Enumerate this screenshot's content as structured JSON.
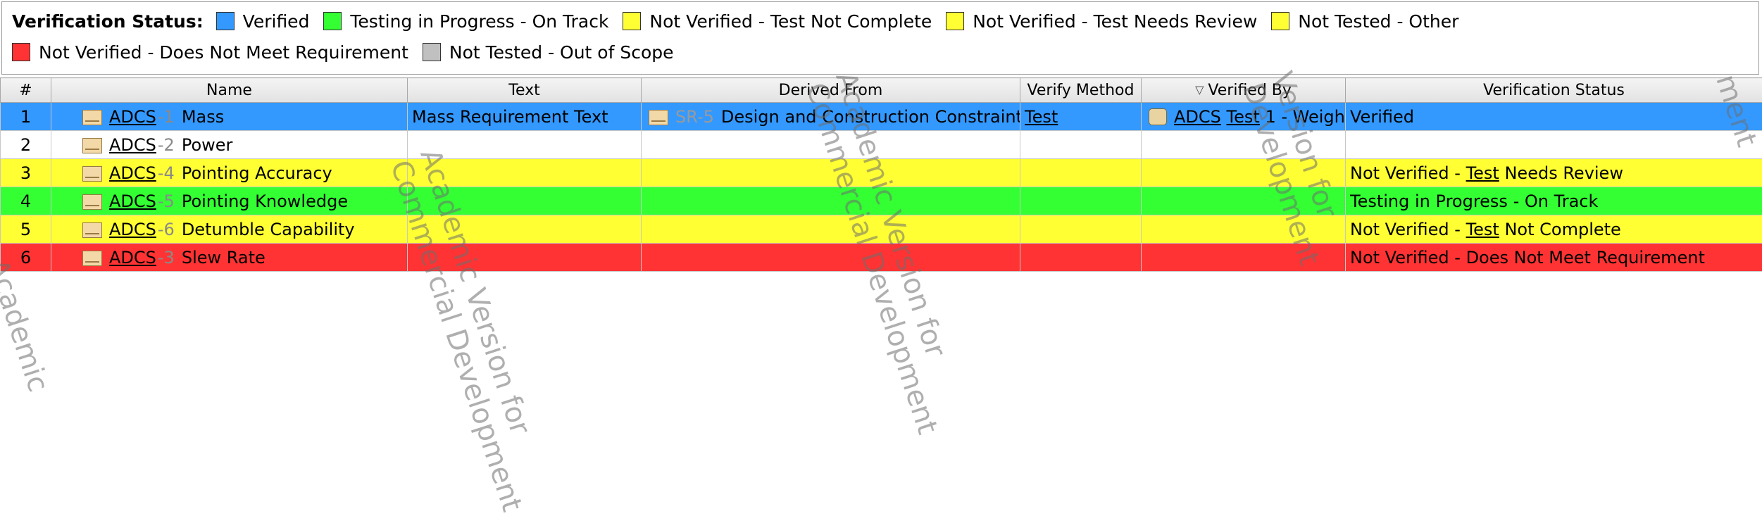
{
  "legend": {
    "title": "Verification Status:",
    "items": [
      {
        "label": "Verified",
        "color": "#3399ff"
      },
      {
        "label": "Testing in Progress - On Track",
        "color": "#33ff33"
      },
      {
        "label": "Not Verified - Test Not Complete",
        "color": "#ffff33"
      },
      {
        "label": "Not Verified - Test Needs Review",
        "color": "#ffff33"
      },
      {
        "label": "Not Tested - Other",
        "color": "#ffff33"
      },
      {
        "label": "Not Verified - Does Not Meet Requirement",
        "color": "#ff3333"
      },
      {
        "label": "Not Tested - Out of Scope",
        "color": "#c0c0c0"
      }
    ]
  },
  "columns": {
    "num": "#",
    "name": "Name",
    "text": "Text",
    "derived_from": "Derived From",
    "verify_method": "Verify Method",
    "verified_by": "Verified By",
    "verification_status": "Verification Status"
  },
  "rows": [
    {
      "num": "1",
      "prefix": "ADCS",
      "id": "-1",
      "name": "Mass",
      "text": "Mass Requirement Text",
      "derived_from": {
        "id": "SR-5",
        "name": "Design and Construction Constraints"
      },
      "verify_method": "Test",
      "verified_by": {
        "prefix": "ADCS",
        "test": "Test",
        "rest": "1 - Weigh"
      },
      "status": {
        "pre": "Verified",
        "link": "",
        "post": ""
      },
      "color": "#3399ff"
    },
    {
      "num": "2",
      "prefix": "ADCS",
      "id": "-2",
      "name": "Power",
      "text": "",
      "derived_from": null,
      "verify_method": "",
      "verified_by": null,
      "status": {
        "pre": "",
        "link": "",
        "post": ""
      },
      "color": "#ffffff"
    },
    {
      "num": "3",
      "prefix": "ADCS",
      "id": "-4",
      "name": "Pointing Accuracy",
      "text": "",
      "derived_from": null,
      "verify_method": "",
      "verified_by": null,
      "status": {
        "pre": "Not Verified - ",
        "link": "Test",
        "post": " Needs Review"
      },
      "color": "#ffff33"
    },
    {
      "num": "4",
      "prefix": "ADCS",
      "id": "-5",
      "name": "Pointing Knowledge",
      "text": "",
      "derived_from": null,
      "verify_method": "",
      "verified_by": null,
      "status": {
        "pre": "Testing in Progress - On Track",
        "link": "",
        "post": ""
      },
      "color": "#33ff33"
    },
    {
      "num": "5",
      "prefix": "ADCS",
      "id": "-6",
      "name": "Detumble Capability",
      "text": "",
      "derived_from": null,
      "verify_method": "",
      "verified_by": null,
      "status": {
        "pre": "Not Verified - ",
        "link": "Test",
        "post": " Not Complete"
      },
      "color": "#ffff33"
    },
    {
      "num": "6",
      "prefix": "ADCS",
      "id": "-3",
      "name": "Slew Rate",
      "text": "",
      "derived_from": null,
      "verify_method": "",
      "verified_by": null,
      "status": {
        "pre": "Not Verified - Does Not Meet Requirement",
        "link": "",
        "post": ""
      },
      "color": "#ff3333"
    }
  ],
  "watermarks": [
    {
      "text": "Academic Version for"
    },
    {
      "text": "Commercial Development"
    },
    {
      "text": "Academic Version for"
    },
    {
      "text": "Commercial Development"
    },
    {
      "text": "Version for"
    },
    {
      "text": "Development"
    },
    {
      "text": "Academic"
    },
    {
      "text": "ment"
    }
  ]
}
